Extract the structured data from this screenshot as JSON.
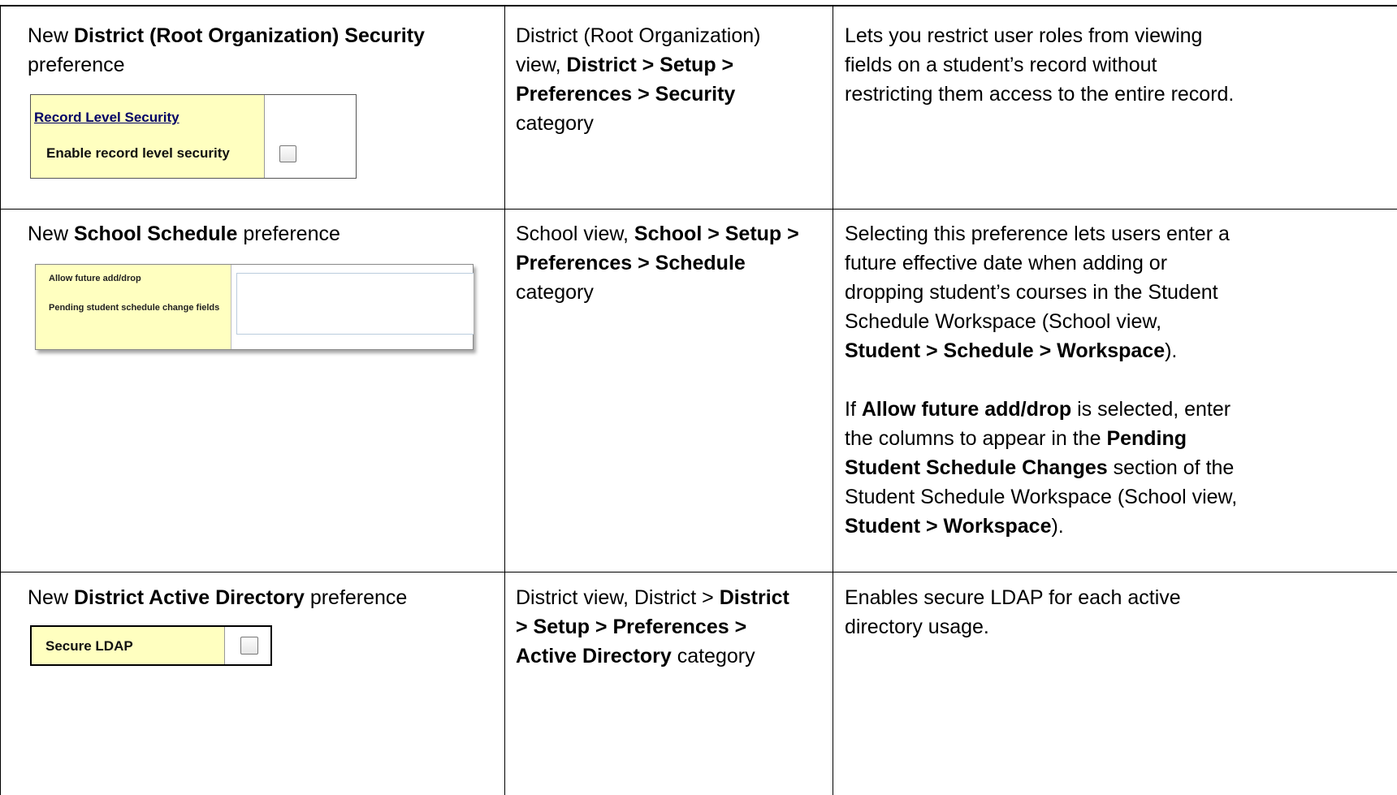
{
  "rows": [
    {
      "col1": {
        "pre": "New ",
        "bold": "District (Root Organization) Security",
        "post": " preference"
      },
      "col2": {
        "line1": "District (Root Organization)",
        "line2_pre": "view, ",
        "line2_bold": "District > Setup >",
        "line3_bold": "Preferences > Security",
        "line4": "category"
      },
      "col3": {
        "lines": [
          "Lets you restrict user roles from viewing",
          "fields on a student’s record without",
          "restricting them access to the entire record."
        ]
      },
      "snapshot": {
        "link": "Record Level Security",
        "field_label": "Enable record level security",
        "checked": false
      }
    },
    {
      "col1": {
        "pre": "New ",
        "bold": "School Schedule",
        "post": " preference"
      },
      "col2": {
        "line1_pre": "School view, ",
        "line1_bold": "School > Setup >",
        "line2_bold": "Preferences > Schedule",
        "line3": "category"
      },
      "col3": {
        "p1_lines": [
          "Selecting this preference lets users enter a",
          "future effective date when adding or",
          "dropping student’s courses in the Student",
          "Schedule Workspace (School view,"
        ],
        "p1_last_bold": "Student > Schedule > Workspace",
        "p1_last_post": ").",
        "p2_l1_pre": "If ",
        "p2_l1_bold": "Allow future add/drop",
        "p2_l1_post": " is selected, enter",
        "p2_l2_pre": "the columns to appear in the ",
        "p2_l2_bold": "Pending",
        "p2_l3_bold": "Student Schedule Changes",
        "p2_l3_post": " section of the",
        "p2_l4": "Student Schedule Workspace (School view,",
        "p2_l5_bold": "Student > Workspace",
        "p2_l5_post": ")."
      },
      "snapshot": {
        "field1": "Allow future add/drop",
        "field2": "Pending student schedule change fields",
        "checked": false,
        "text_value": ""
      }
    },
    {
      "col1": {
        "pre": "New ",
        "bold": "District Active Directory",
        "post": " preference"
      },
      "col2": {
        "line1_pre": "District view, District > ",
        "line1_bold": "District",
        "line2_bold": "> Setup > Preferences >",
        "line3_bold": "Active Directory",
        "line3_post": " category"
      },
      "col3": {
        "lines": [
          "Enables secure LDAP for each active",
          "directory usage."
        ]
      },
      "snapshot": {
        "field_label": "Secure LDAP",
        "checked": false
      }
    }
  ],
  "colors": {
    "label_bg": "#ffffc0",
    "link": "#000066",
    "border": "#000000"
  }
}
